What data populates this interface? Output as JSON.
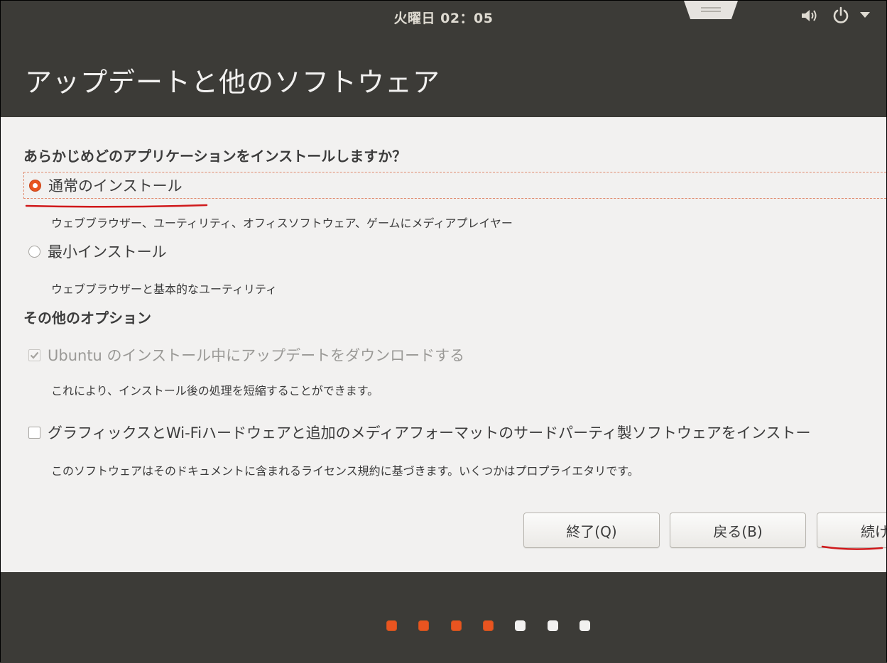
{
  "topbar": {
    "clock": "火曜日 02：05",
    "icons": [
      "volume-icon",
      "power-icon",
      "menu-arrow-icon"
    ]
  },
  "header": {
    "title": "アップデートと他のソフトウェア"
  },
  "install_type": {
    "question": "あらかじめどのアプリケーションをインストールしますか？",
    "options": [
      {
        "label": "通常のインストール",
        "description": "ウェブブラウザー、ユーティリティ、オフィスソフトウェア、ゲームにメディアプレイヤー",
        "selected": true
      },
      {
        "label": "最小インストール",
        "description": "ウェブブラウザーと基本的なユーティリティ",
        "selected": false
      }
    ]
  },
  "other_options": {
    "heading": "その他のオプション",
    "items": [
      {
        "label": "Ubuntu のインストール中にアップデートをダウンロードする",
        "description": "これにより、インストール後の処理を短縮することができます。",
        "checked": true,
        "disabled": true
      },
      {
        "label": "グラフィックスとWi-Fiハードウェアと追加のメディアフォーマットのサードパーティ製ソフトウェアをインストー",
        "description": "このソフトウェアはそのドキュメントに含まれるライセンス規約に基づきます。いくつかはプロプライエタリです。",
        "checked": false,
        "disabled": false
      }
    ]
  },
  "buttons": {
    "quit": "終了(Q)",
    "back": "戻る(B)",
    "continue": "続け"
  },
  "progress": {
    "completed_steps": 4,
    "total_steps": 7
  },
  "colors": {
    "accent": "#e95420",
    "annotation": "#d0191b",
    "panel": "#3c3b37",
    "content_bg": "#f2f1f0"
  }
}
